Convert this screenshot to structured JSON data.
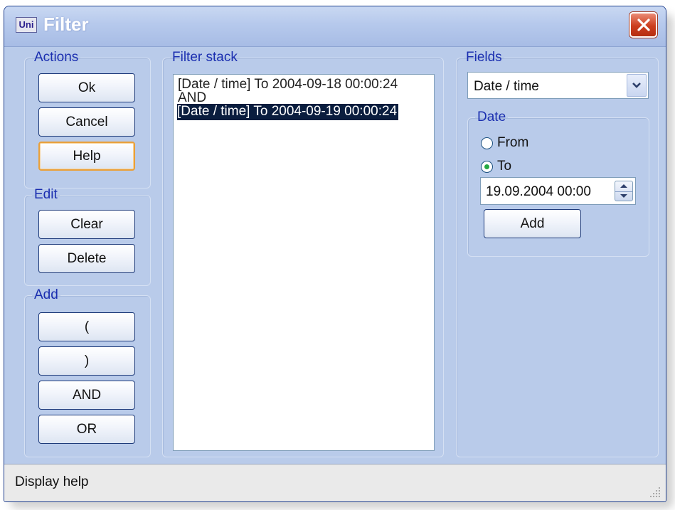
{
  "window": {
    "title": "Filter",
    "app_icon_text": "Uni"
  },
  "actions": {
    "legend": "Actions",
    "ok": "Ok",
    "cancel": "Cancel",
    "help": "Help"
  },
  "edit": {
    "legend": "Edit",
    "clear": "Clear",
    "delete": "Delete"
  },
  "add": {
    "legend": "Add",
    "open_paren": "(",
    "close_paren": ")",
    "and": "AND",
    "or": "OR"
  },
  "filter_stack": {
    "legend": "Filter stack",
    "items": [
      "[Date / time] To 2004-09-18 00:00:24",
      "AND",
      "[Date / time] To 2004-09-19 00:00:24"
    ],
    "selected_index": 2
  },
  "fields": {
    "legend": "Fields",
    "selected_field": "Date / time",
    "date": {
      "legend": "Date",
      "from_label": "From",
      "to_label": "To",
      "selected": "To",
      "datetime_value": "19.09.2004 00:00",
      "add_label": "Add"
    }
  },
  "status": {
    "text": "Display help"
  },
  "colors": {
    "accent": "#1b2fb0",
    "window_bg": "#b9cbea",
    "close_red": "#cc3e1f",
    "focus": "#e9a03a"
  }
}
